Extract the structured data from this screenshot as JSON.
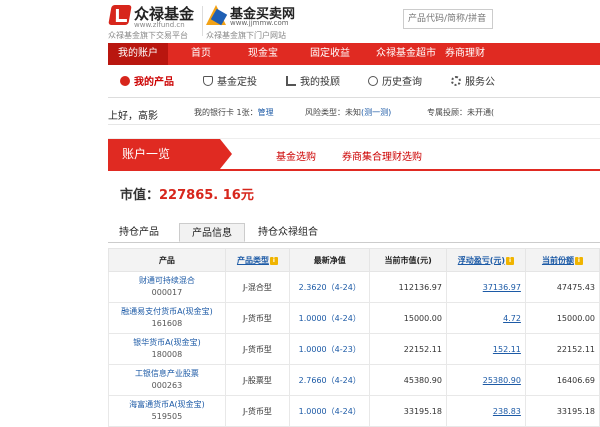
{
  "header": {
    "logo1_name": "众禄基金",
    "logo1_url": "www.zlfund.cn",
    "logo1_tag": "众禄基金旗下交易平台",
    "logo2_name": "基金买卖网",
    "logo2_url": "www.jjmmw.com",
    "logo2_tag": "众禄基金旗下门户网站",
    "search_placeholder": "产品代码/简称/拼音"
  },
  "nav": {
    "items": [
      "我的账户",
      "首页",
      "现金宝",
      "固定收益",
      "众禄基金超市",
      "券商理财"
    ]
  },
  "subnav": {
    "tabs": [
      "我的产品",
      "基金定投",
      "我的投顾",
      "历史查询",
      "服务公"
    ]
  },
  "user": {
    "greeting": "上好，高影",
    "bank_label": "我的银行卡",
    "bank_count": "1张：",
    "bank_manage": "管理",
    "risk_label": "风险类型：未知",
    "risk_link": "(测一测)",
    "advisor_label": "专属投顾：未开通("
  },
  "banner": {
    "title": "账户一览",
    "link1": "基金选购",
    "link2": "券商集合理财选购"
  },
  "market_value": {
    "label": "市值：",
    "amount": "227865. 16元"
  },
  "section_tabs": [
    "持仓产品",
    "产品信息",
    "持仓众禄组合"
  ],
  "table": {
    "headers": [
      "产品",
      "产品类型",
      "最新净值",
      "当前市值(元)",
      "浮动盈亏(元)",
      "当前份额"
    ],
    "rows": [
      {
        "name": "财通可持续混合",
        "code": "000017",
        "type": "J-混合型",
        "nav": "2.3620（4-24）",
        "value": "112136.97",
        "pnl": "37136.97",
        "shares": "47475.43"
      },
      {
        "name": "融通易支付货币A(现金宝)",
        "code": "161608",
        "type": "J-货币型",
        "nav": "1.0000（4-24）",
        "value": "15000.00",
        "pnl": "4.72",
        "shares": "15000.00"
      },
      {
        "name": "银华货币A(现金宝)",
        "code": "180008",
        "type": "J-货币型",
        "nav": "1.0000（4-23）",
        "value": "22152.11",
        "pnl": "152.11",
        "shares": "22152.11"
      },
      {
        "name": "工银信息产业股票",
        "code": "000263",
        "type": "J-股票型",
        "nav": "2.7660（4-24）",
        "value": "45380.90",
        "pnl": "25380.90",
        "shares": "16406.69"
      },
      {
        "name": "海富通货币A(现金宝)",
        "code": "519505",
        "type": "J-货币型",
        "nav": "1.0000（4-24）",
        "value": "33195.18",
        "pnl": "238.83",
        "shares": "33195.18"
      }
    ]
  },
  "colors": {
    "brand_red": "#e02a22",
    "link_blue": "#1c5aa6"
  }
}
